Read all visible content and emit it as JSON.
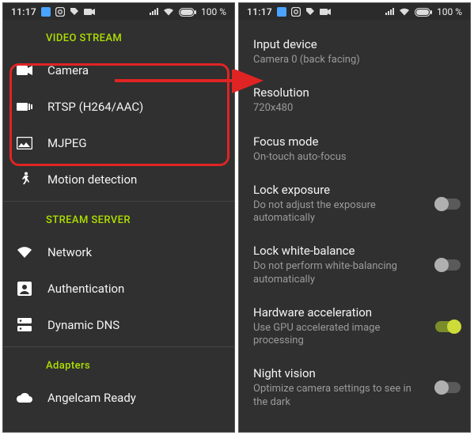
{
  "statusbar": {
    "time": "11:17",
    "battery": "100 %"
  },
  "left": {
    "sections": {
      "video_stream": "VIDEO STREAM",
      "stream_server": "STREAM SERVER",
      "adapters": "Adapters"
    },
    "items": {
      "camera": "Camera",
      "rtsp": "RTSP (H264/AAC)",
      "mjpeg": "MJPEG",
      "motion": "Motion detection",
      "network": "Network",
      "auth": "Authentication",
      "ddns": "Dynamic DNS",
      "angelcam": "Angelcam Ready"
    }
  },
  "right": {
    "input_device": {
      "title": "Input device",
      "sub": "Camera 0 (back facing)"
    },
    "resolution": {
      "title": "Resolution",
      "sub": "720x480"
    },
    "focus_mode": {
      "title": "Focus mode",
      "sub": "On-touch auto-focus"
    },
    "lock_exposure": {
      "title": "Lock exposure",
      "sub": "Do not adjust the exposure automatically"
    },
    "lock_wb": {
      "title": "Lock white-balance",
      "sub": "Do not perform white-balancing automatically"
    },
    "hw_accel": {
      "title": "Hardware acceleration",
      "sub": "Use GPU accelerated image processing"
    },
    "night_vision": {
      "title": "Night vision",
      "sub": "Optimize camera settings to see in the dark"
    }
  }
}
